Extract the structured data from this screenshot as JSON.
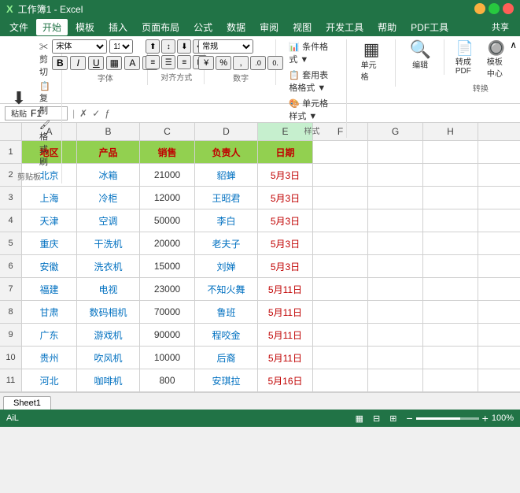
{
  "titleBar": {
    "title": "工作簿1 - Excel",
    "shareLabel": "共享"
  },
  "menuBar": {
    "items": [
      "文件",
      "开始",
      "模板",
      "插入",
      "页面布局",
      "公式",
      "数据",
      "审阅",
      "视图",
      "开发工具",
      "帮助",
      "PDF工具"
    ]
  },
  "ribbon": {
    "groups": [
      {
        "name": "剪贴板",
        "label": "剪贴板"
      },
      {
        "name": "字体",
        "label": "字体"
      },
      {
        "name": "对齐方式",
        "label": "对齐方式"
      },
      {
        "name": "数字",
        "label": "数字"
      },
      {
        "name": "样式",
        "label": "样式",
        "items": [
          "条件格式 ▼",
          "套用表格格式 ▼",
          "单元格样式 ▼"
        ]
      },
      {
        "name": "单元格",
        "label": "单元格"
      },
      {
        "name": "编辑",
        "label": "编辑"
      },
      {
        "name": "转换",
        "label": "转换",
        "items": [
          "转成PDF",
          "模板中心"
        ]
      }
    ]
  },
  "formulaBar": {
    "nameBox": "F1",
    "formula": ""
  },
  "columns": {
    "headers": [
      "A",
      "B",
      "C",
      "D",
      "E",
      "F",
      "G",
      "H"
    ],
    "colA": {
      "label": "地区",
      "width": 70
    },
    "colB": {
      "label": "产品",
      "width": 80
    },
    "colC": {
      "label": "销售",
      "width": 70
    },
    "colD": {
      "label": "负责人",
      "width": 80
    },
    "colE": {
      "label": "日期",
      "width": 70
    }
  },
  "tableHeaders": {
    "a": "地区",
    "b": "产品",
    "c": "销售",
    "d": "负责人",
    "e": "日期"
  },
  "rows": [
    {
      "row": 1,
      "a": "地区",
      "b": "产品",
      "c": "销售",
      "d": "负责人",
      "e": "日期",
      "isHeader": true
    },
    {
      "row": 2,
      "a": "北京",
      "b": "冰箱",
      "c": "21000",
      "d": "貂蝉",
      "e": "5月3日"
    },
    {
      "row": 3,
      "a": "上海",
      "b": "冷柜",
      "c": "12000",
      "d": "王昭君",
      "e": "5月3日"
    },
    {
      "row": 4,
      "a": "天津",
      "b": "空调",
      "c": "50000",
      "d": "李白",
      "e": "5月3日"
    },
    {
      "row": 5,
      "a": "重庆",
      "b": "干洗机",
      "c": "20000",
      "d": "老夫子",
      "e": "5月3日"
    },
    {
      "row": 6,
      "a": "安徽",
      "b": "洗衣机",
      "c": "15000",
      "d": "刘婵",
      "e": "5月3日"
    },
    {
      "row": 7,
      "a": "福建",
      "b": "电视",
      "c": "23000",
      "d": "不知火舞",
      "e": "5月11日"
    },
    {
      "row": 8,
      "a": "甘肃",
      "b": "数码相机",
      "c": "70000",
      "d": "鲁班",
      "e": "5月11日"
    },
    {
      "row": 9,
      "a": "广东",
      "b": "游戏机",
      "c": "90000",
      "d": "程咬金",
      "e": "5月11日"
    },
    {
      "row": 10,
      "a": "贵州",
      "b": "吹风机",
      "c": "10000",
      "d": "后裔",
      "e": "5月11日"
    },
    {
      "row": 11,
      "a": "河北",
      "b": "咖啡机",
      "c": "800",
      "d": "安琪拉",
      "e": "5月16日"
    }
  ],
  "sheetTabs": {
    "tabs": [
      "Sheet1"
    ],
    "active": "Sheet1"
  },
  "statusBar": {
    "left": "AiL",
    "zoom": "100%"
  }
}
